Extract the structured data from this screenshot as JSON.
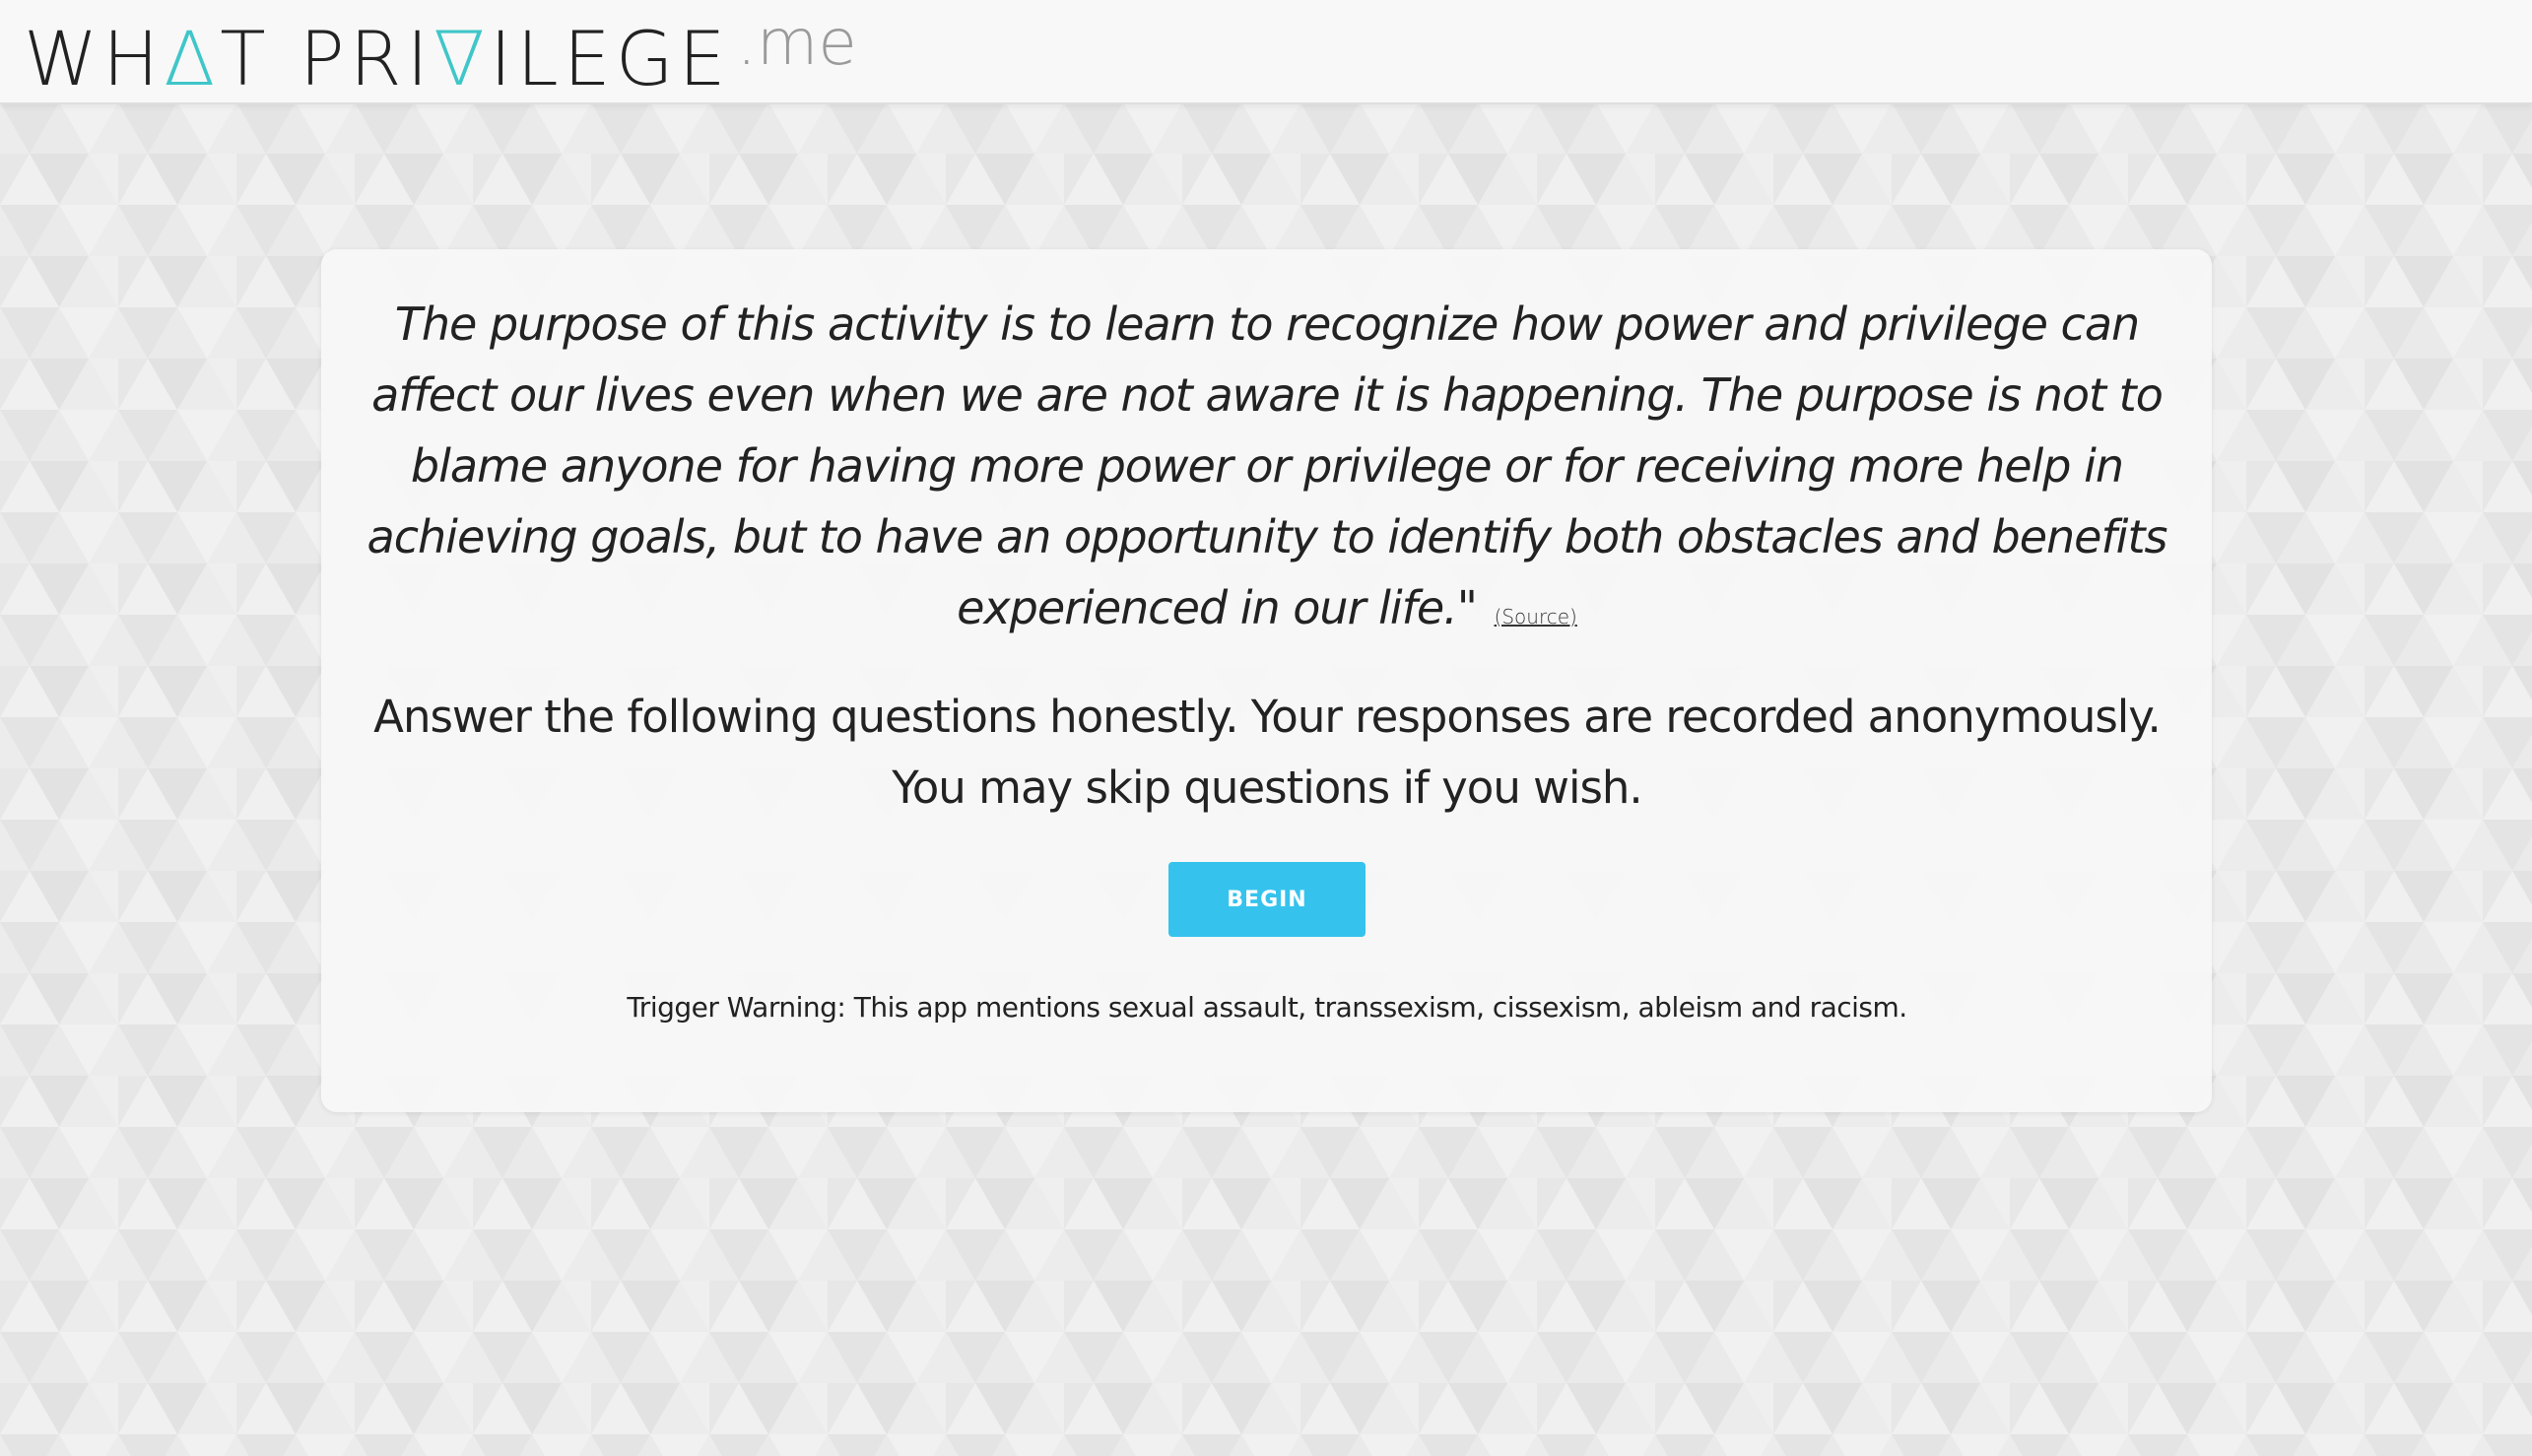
{
  "header": {
    "logo_part1": "WH",
    "logo_tri1": "Δ",
    "logo_part2": "T PRI",
    "logo_tri2": "∇",
    "logo_part3": "ILEGE",
    "logo_tld": ".me"
  },
  "intro": {
    "quote": "The purpose of this activity is to learn to recognize how power and privilege can affect our lives even when we are not aware it is happening. The purpose is not to blame anyone for having more power or privilege or for receiving more help in achieving goals, but to have an opportunity to identify both obstacles and benefits experienced in our life.\"",
    "source_label": "(Source)",
    "instructions": "Answer the following questions honestly. Your responses are recorded anonymously. You may skip questions if you wish.",
    "begin_label": "BEGIN",
    "trigger_warning": "Trigger Warning: This app mentions sexual assault, transsexism, cissexism, ableism and racism."
  },
  "colors": {
    "accent_teal": "#3fc6c9",
    "button_blue": "#35c3ee",
    "background": "#ececec"
  }
}
